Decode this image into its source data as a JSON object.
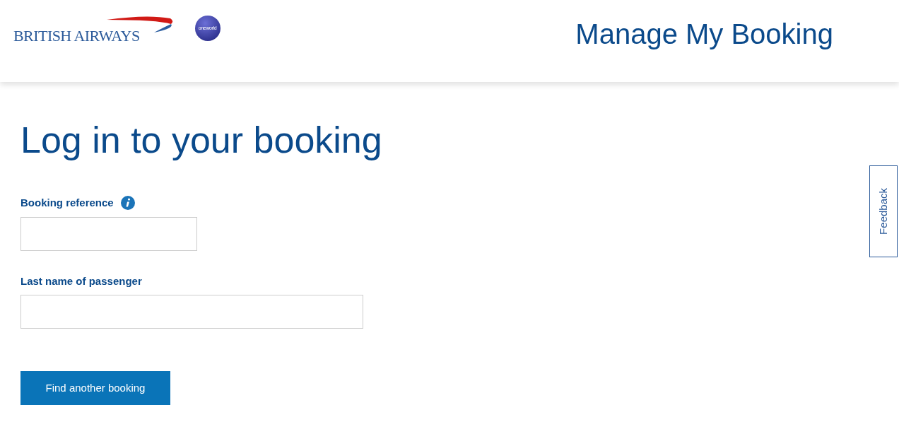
{
  "header": {
    "logo_text": "BRITISH AIRWAYS",
    "alliance_text": "oneworld",
    "title": "Manage My Booking"
  },
  "page": {
    "heading": "Log in to your booking",
    "fields": [
      {
        "label": "Booking reference",
        "info": true
      },
      {
        "label": "Last name of passenger",
        "info": false
      }
    ],
    "button": "Find another booking"
  },
  "feedback": "Feedback"
}
